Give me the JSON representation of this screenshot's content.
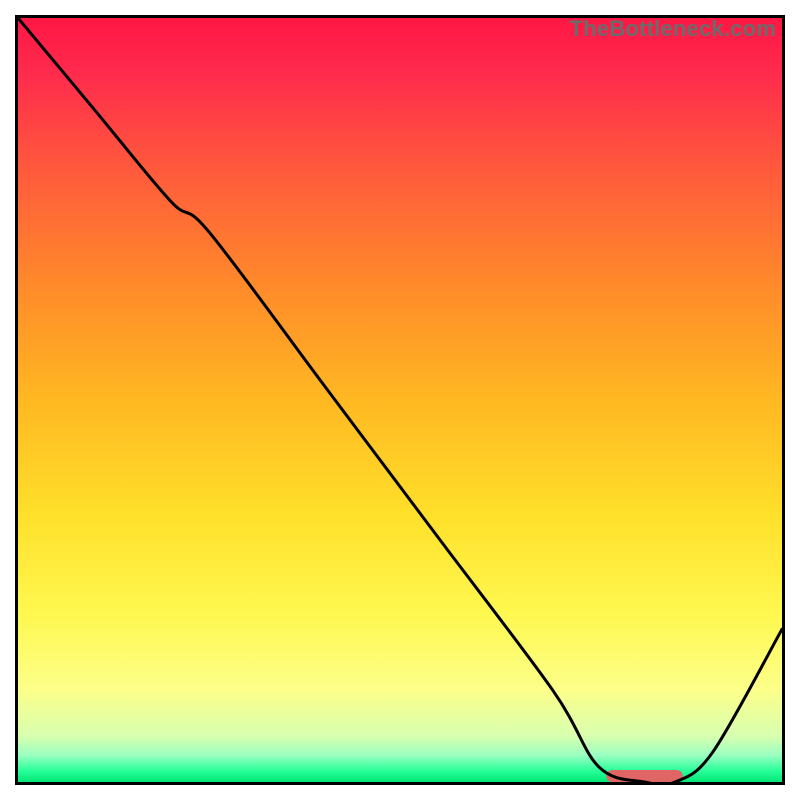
{
  "watermark": "TheBottleneck.com",
  "chart_data": {
    "type": "line",
    "title": "",
    "xlabel": "",
    "ylabel": "",
    "xlim": [
      0,
      100
    ],
    "ylim": [
      0,
      100
    ],
    "grid": false,
    "legend": false,
    "series": [
      {
        "name": "curve",
        "x": [
          0,
          10,
          20,
          25,
          40,
          55,
          70,
          76,
          82,
          86,
          91,
          100
        ],
        "y": [
          100,
          88,
          76,
          72,
          52,
          32,
          12,
          2,
          0,
          0,
          4,
          20
        ]
      }
    ],
    "marker": {
      "name": "optimal-range",
      "x_start": 77,
      "x_end": 87,
      "y": 0,
      "color": "#e06666"
    },
    "gradient_stops": [
      {
        "offset": 0.0,
        "color": "#ff1744"
      },
      {
        "offset": 0.07,
        "color": "#ff2a4d"
      },
      {
        "offset": 0.2,
        "color": "#ff5a3c"
      },
      {
        "offset": 0.35,
        "color": "#ff8a2a"
      },
      {
        "offset": 0.5,
        "color": "#ffb822"
      },
      {
        "offset": 0.65,
        "color": "#ffe02a"
      },
      {
        "offset": 0.78,
        "color": "#fff850"
      },
      {
        "offset": 0.88,
        "color": "#fcff8a"
      },
      {
        "offset": 0.94,
        "color": "#d8ffb0"
      },
      {
        "offset": 0.965,
        "color": "#9affc0"
      },
      {
        "offset": 0.985,
        "color": "#2aff9a"
      },
      {
        "offset": 1.0,
        "color": "#00e676"
      }
    ]
  }
}
